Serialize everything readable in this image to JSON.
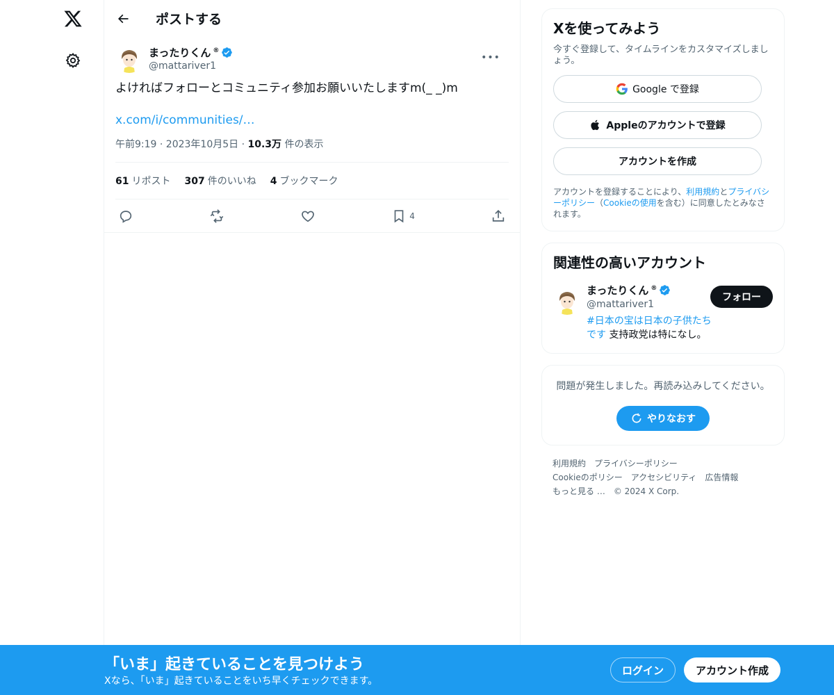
{
  "nav": {
    "logo_icon": "x-logo-icon",
    "settings_icon": "gear-icon"
  },
  "header": {
    "title": "ポストする"
  },
  "post": {
    "author_name": "まったりくん",
    "author_reg": "®",
    "author_handle": "@mattariver1",
    "text": "よければフォローとコミュニティ参加お願いいたしますm(_ _)m",
    "link": "x.com/i/communities/…",
    "meta_prefix": "午前9:19 · 2023年10月5日 · ",
    "views_count": "10.3万",
    "views_label": " 件の表示",
    "stats": {
      "reposts_count": "61",
      "reposts_label": "リポスト",
      "likes_count": "307",
      "likes_label": "件のいいね",
      "bookmarks_count": "4",
      "bookmarks_label": "ブックマーク"
    },
    "actions": {
      "bookmark_count": "4"
    }
  },
  "signup_card": {
    "title": "Xを使ってみよう",
    "subtitle": "今すぐ登録して、タイムラインをカスタマイズしましょう。",
    "google_label": "Google で登録",
    "apple_label": "Appleのアカウントで登録",
    "create_label": "アカウントを作成",
    "legal_prefix": "アカウントを登録することにより、",
    "legal_terms": "利用規約",
    "legal_and": "と",
    "legal_privacy": "プライバシーポリシー",
    "legal_paren_open": "（",
    "legal_cookie": "Cookieの使用",
    "legal_suffix": "を含む）に同意したとみなされます。"
  },
  "related_card": {
    "title": "関連性の高いアカウント",
    "name": "まったりくん",
    "reg": "®",
    "handle": "@mattariver1",
    "bio_tag": "#日本の宝は日本の子供たちです",
    "bio_text": " 支持政党は特になし。",
    "follow_label": "フォロー"
  },
  "error_card": {
    "message": "問題が発生しました。再読み込みしてください。",
    "retry_label": "やりなおす"
  },
  "footer": {
    "terms": "利用規約",
    "privacy": "プライバシーポリシー",
    "cookie": "Cookieのポリシー",
    "accessibility": "アクセシビリティ",
    "ads": "広告情報",
    "more": "もっと見る …",
    "copyright": "© 2024 X Corp."
  },
  "bottom_bar": {
    "title": "「いま」起きていることを見つけよう",
    "subtitle": "Xなら、「いま」起きていることをいち早くチェックできます。",
    "login_label": "ログイン",
    "create_label": "アカウント作成"
  },
  "colors": {
    "accent": "#1d9bf0",
    "text": "#0f1419",
    "muted": "#536471",
    "border": "#eff3f4"
  }
}
